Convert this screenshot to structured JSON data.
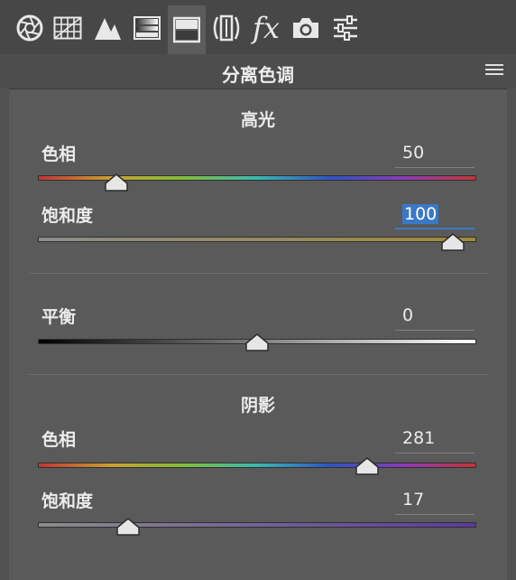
{
  "toolbar": {
    "tabs": [
      {
        "icon": "aperture-icon"
      },
      {
        "icon": "grid-table-icon"
      },
      {
        "icon": "mountains-icon"
      },
      {
        "icon": "gradient-bars-icon"
      },
      {
        "icon": "split-toning-icon",
        "active": true
      },
      {
        "icon": "lens-correction-icon"
      },
      {
        "icon": "fx-icon",
        "label": "fx"
      },
      {
        "icon": "camera-icon"
      },
      {
        "icon": "sliders-icon"
      }
    ]
  },
  "panel": {
    "title": "分离色调",
    "menu_icon": "hamburger-menu-icon"
  },
  "highlights": {
    "title": "高光",
    "hue": {
      "label": "色相",
      "value": "50",
      "position": 0.14
    },
    "saturation": {
      "label": "饱和度",
      "value": "100",
      "position": 1.0,
      "selected": true
    }
  },
  "balance": {
    "label": "平衡",
    "value": "0",
    "position": 0.5
  },
  "shadows": {
    "title": "阴影",
    "hue": {
      "label": "色相",
      "value": "281",
      "position": 0.78
    },
    "saturation": {
      "label": "饱和度",
      "value": "17",
      "position": 0.17
    }
  },
  "colors": {
    "toolbar_bg": "#474747",
    "panel_bg": "#5a5a5a",
    "selection": "#3a78c8"
  }
}
